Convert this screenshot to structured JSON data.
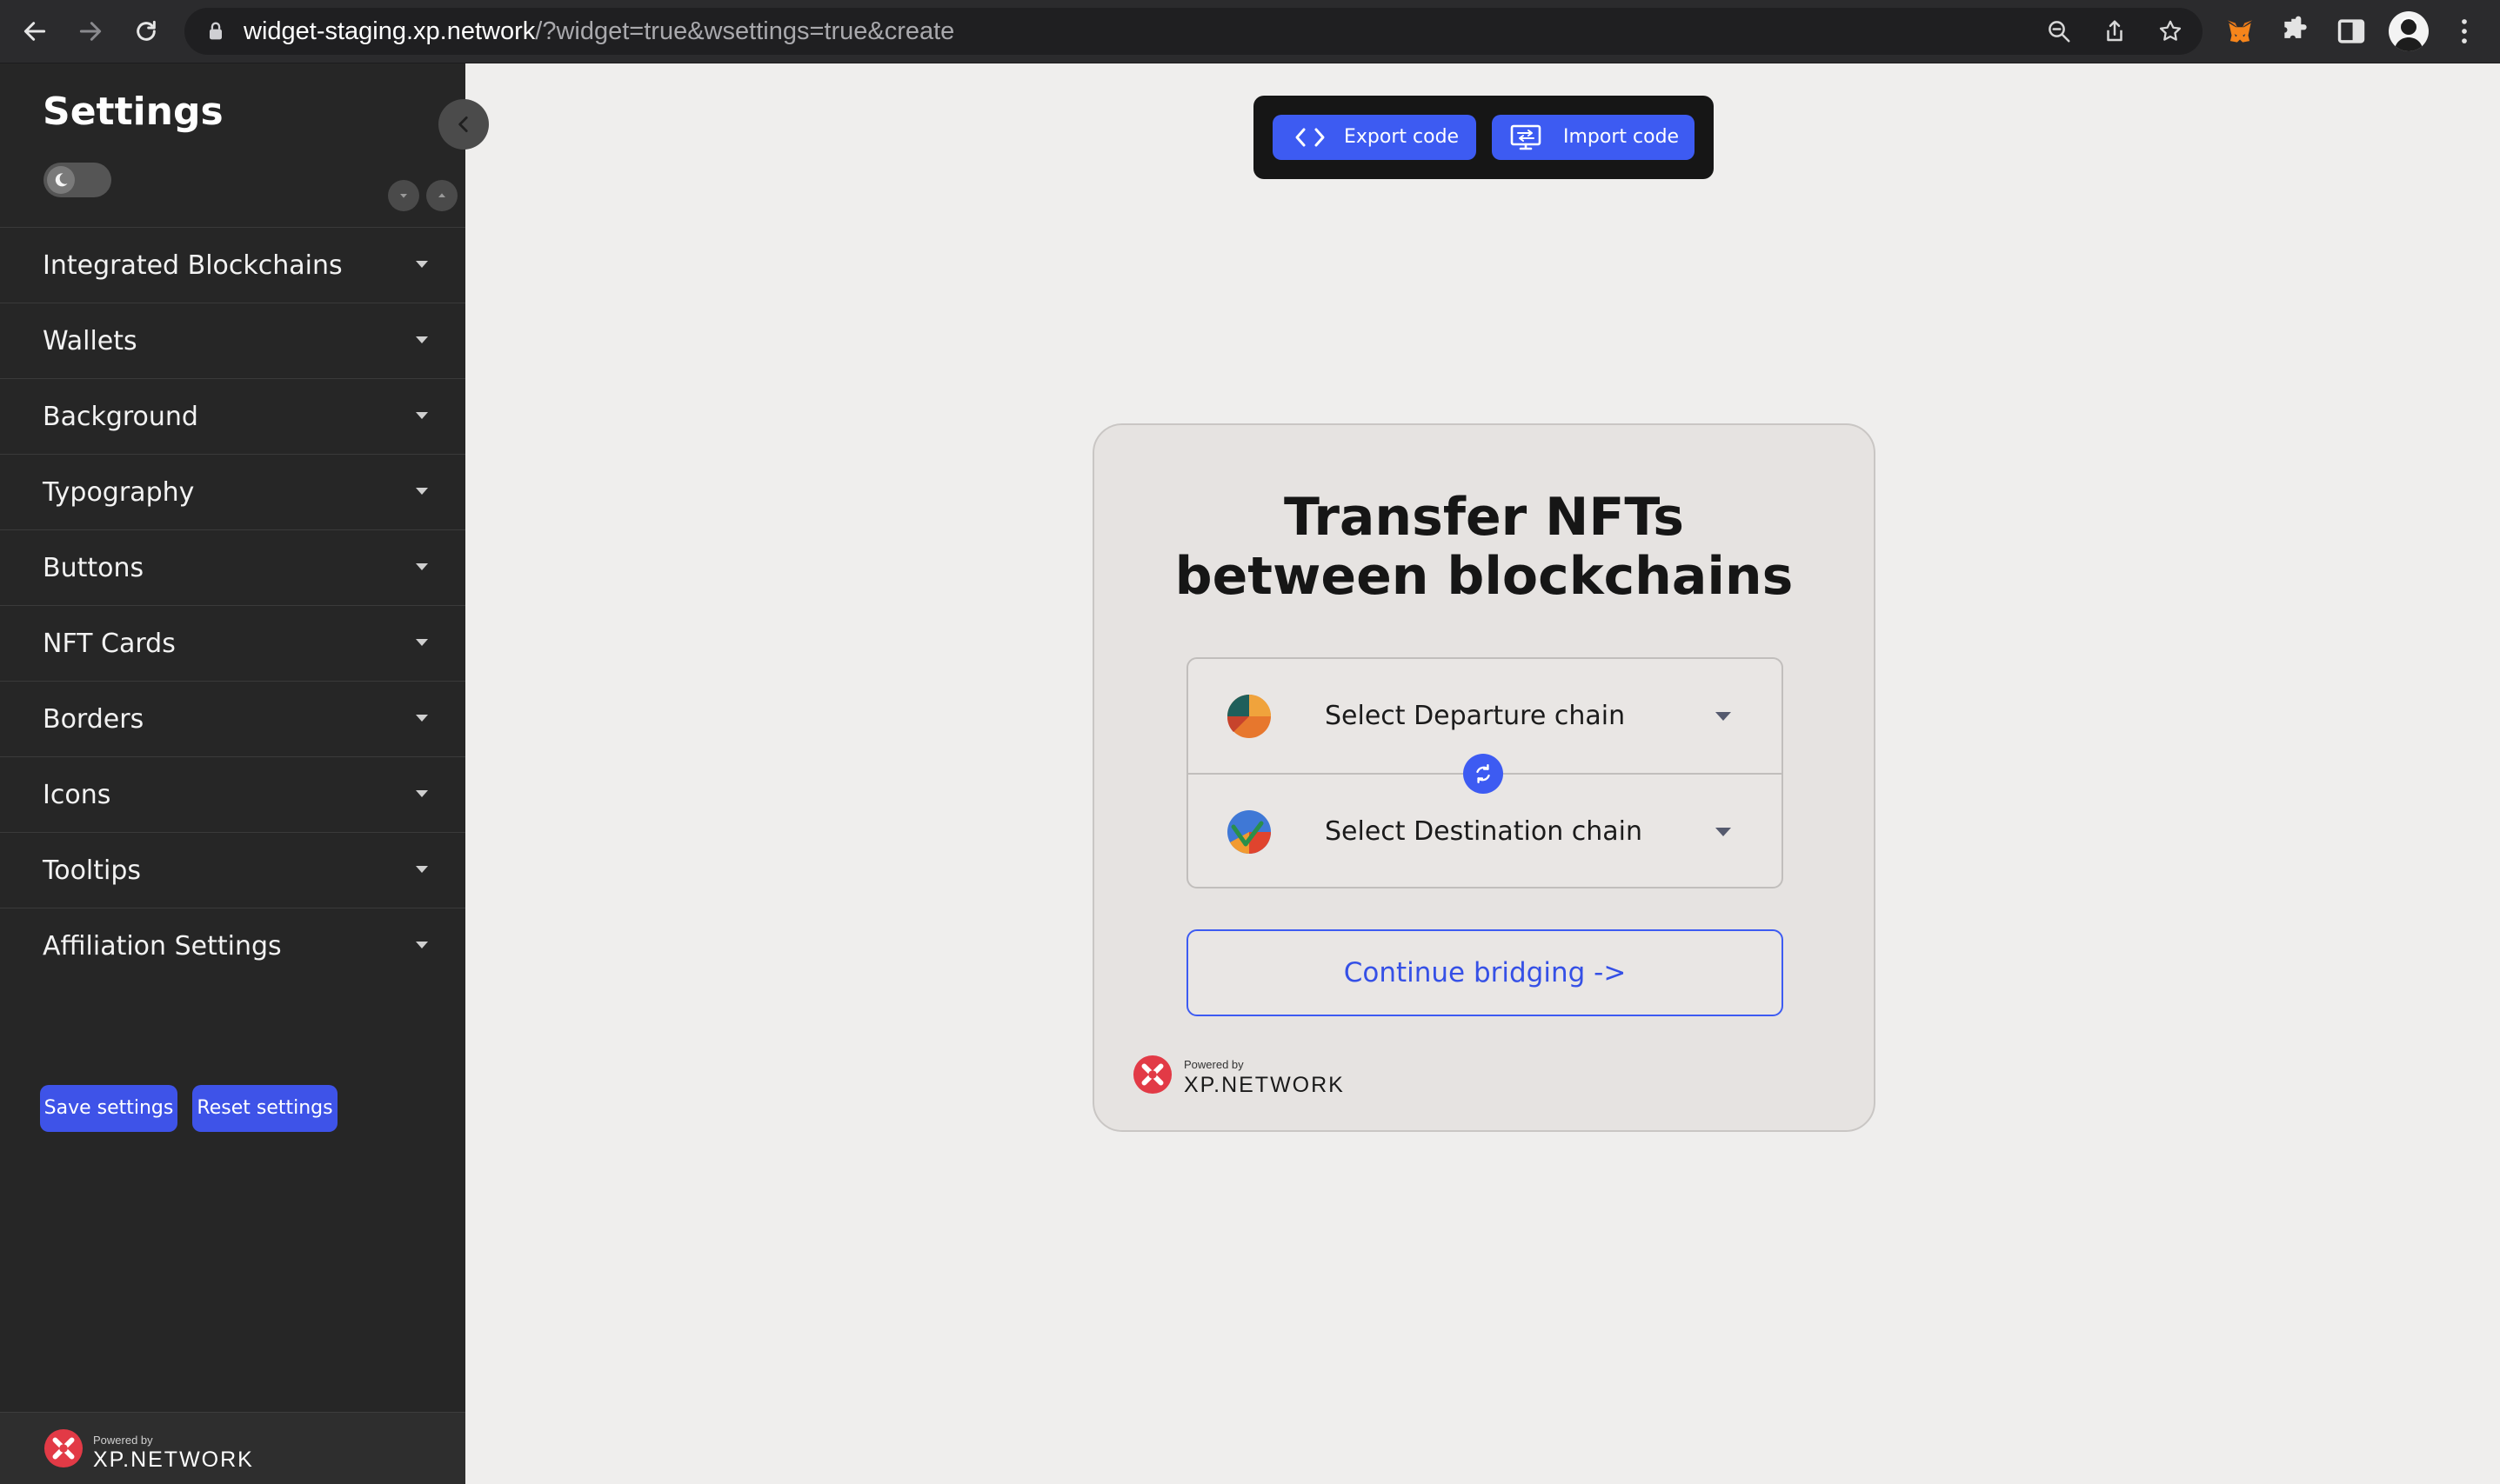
{
  "browser": {
    "url_host": "widget-staging.xp.network",
    "url_rest": "/?widget=true&wsettings=true&create"
  },
  "sidebar": {
    "title": "Settings",
    "items": [
      {
        "label": "Integrated Blockchains"
      },
      {
        "label": "Wallets"
      },
      {
        "label": "Background"
      },
      {
        "label": "Typography"
      },
      {
        "label": "Buttons"
      },
      {
        "label": "NFT Cards"
      },
      {
        "label": "Borders"
      },
      {
        "label": "Icons"
      },
      {
        "label": "Tooltips"
      },
      {
        "label": "Affiliation Settings"
      }
    ],
    "save_label": "Save settings",
    "reset_label": "Reset settings",
    "footer_powered": "Powered by",
    "footer_brand": "XP.NETWORK"
  },
  "toolbar": {
    "export_label": "Export code",
    "import_label": "Import code"
  },
  "widget": {
    "title_line1": "Transfer NFTs",
    "title_line2": "between blockchains",
    "departure_label": "Select Departure chain",
    "destination_label": "Select Destination chain",
    "continue_label": "Continue bridging ->",
    "powered": "Powered by",
    "brand": "XP.NETWORK"
  },
  "colors": {
    "accent": "#3d5bf2",
    "sidebar_bg": "#262626",
    "page_bg": "#efeeed",
    "card_bg": "#e6e3e1",
    "brand_red": "#e23a46"
  }
}
